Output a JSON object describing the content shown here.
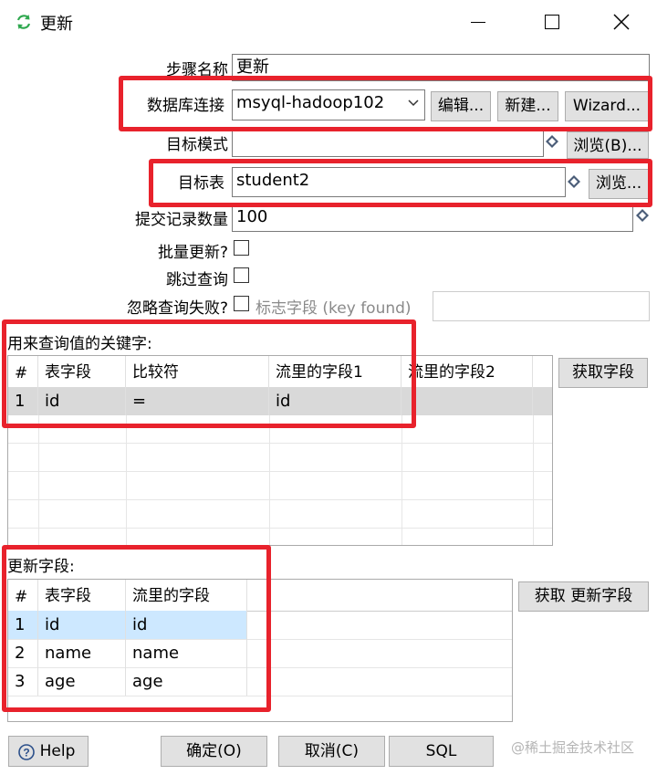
{
  "window": {
    "title": "更新"
  },
  "form": {
    "step_name_label": "步骤名称",
    "step_name_value": "更新",
    "connection_label": "数据库连接",
    "connection_value": "msyql-hadoop102",
    "edit_btn": "编辑...",
    "new_btn": "新建...",
    "wizard_btn": "Wizard...",
    "schema_label": "目标模式",
    "schema_value": "",
    "schema_browse": "浏览(B)...",
    "table_label": "目标表",
    "table_value": "student2",
    "table_browse": "浏览...",
    "commit_label": "提交记录数量",
    "commit_value": "100",
    "batch_label": "批量更新?",
    "skip_lookup_label": "跳过查询",
    "ignore_fail_label": "忽略查询失败?",
    "flag_field_label": "标志字段 (key found)",
    "flag_field_value": ""
  },
  "keys_section": {
    "title": "用来查询值的关键字:",
    "get_fields_btn": "获取字段",
    "columns": [
      "#",
      "表字段",
      "比较符",
      "流里的字段1",
      "流里的字段2"
    ],
    "rows": [
      {
        "num": "1",
        "table_field": "id",
        "comparator": "=",
        "stream1": "id",
        "stream2": ""
      }
    ]
  },
  "update_section": {
    "title": "更新字段:",
    "get_update_btn": "获取 更新字段",
    "columns": [
      "#",
      "表字段",
      "流里的字段"
    ],
    "rows": [
      {
        "num": "1",
        "table_field": "id",
        "stream_field": "id"
      },
      {
        "num": "2",
        "table_field": "name",
        "stream_field": "name"
      },
      {
        "num": "3",
        "table_field": "age",
        "stream_field": "age"
      }
    ]
  },
  "bottom": {
    "help": "Help",
    "ok": "确定(O)",
    "cancel": "取消(C)",
    "sql": "SQL",
    "watermark": "@稀土掘金技术社区"
  },
  "colors": {
    "highlight_red": "#e8222c",
    "selected_row": "#d9d9d9",
    "selected_blue": "#cde8ff",
    "title_icon": "#2fa84f"
  }
}
